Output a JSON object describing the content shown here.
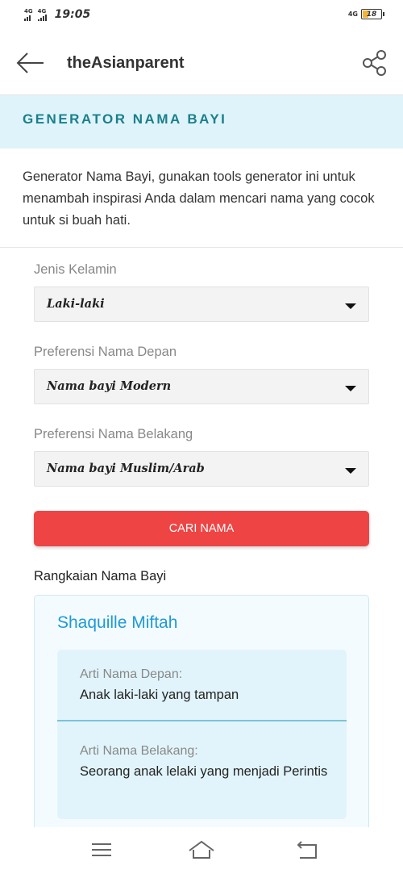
{
  "status_bar": {
    "network_1": "4G",
    "network_2": "4G",
    "time": "19:05",
    "network_right": "4G",
    "battery_level": "18"
  },
  "app_bar": {
    "title": "theAsianparent",
    "back_icon": "arrow-left-icon",
    "share_icon": "share-icon"
  },
  "section": {
    "title": "GENERATOR NAMA BAYI"
  },
  "intro": "Generator Nama Bayi, gunakan tools generator ini untuk menambah inspirasi Anda dalam mencari nama yang cocok untuk si buah hati.",
  "form": {
    "gender_label": "Jenis Kelamin",
    "gender_value": "Laki-laki",
    "first_pref_label": "Preferensi Nama Depan",
    "first_pref_value": "Nama bayi Modern",
    "last_pref_label": "Preferensi Nama Belakang",
    "last_pref_value": "Nama bayi Muslim/Arab",
    "search_button": "CARI NAMA"
  },
  "result": {
    "heading": "Rangkaian Nama Bayi",
    "name": "Shaquille Miftah",
    "first_meaning_label": "Arti Nama Depan:",
    "first_meaning": "Anak laki-laki yang tampan",
    "last_meaning_label": "Arti Nama Belakang:",
    "last_meaning": "Seorang anak lelaki yang menjadi Perintis"
  },
  "nav_bar": {
    "menu_icon": "menu-icon",
    "home_icon": "home-icon",
    "back_icon": "return-icon"
  },
  "colors": {
    "accent": "#1a7f8c",
    "header_bg": "#dff4fa",
    "button": "#ef4444",
    "name_link": "#1f9ad6"
  }
}
